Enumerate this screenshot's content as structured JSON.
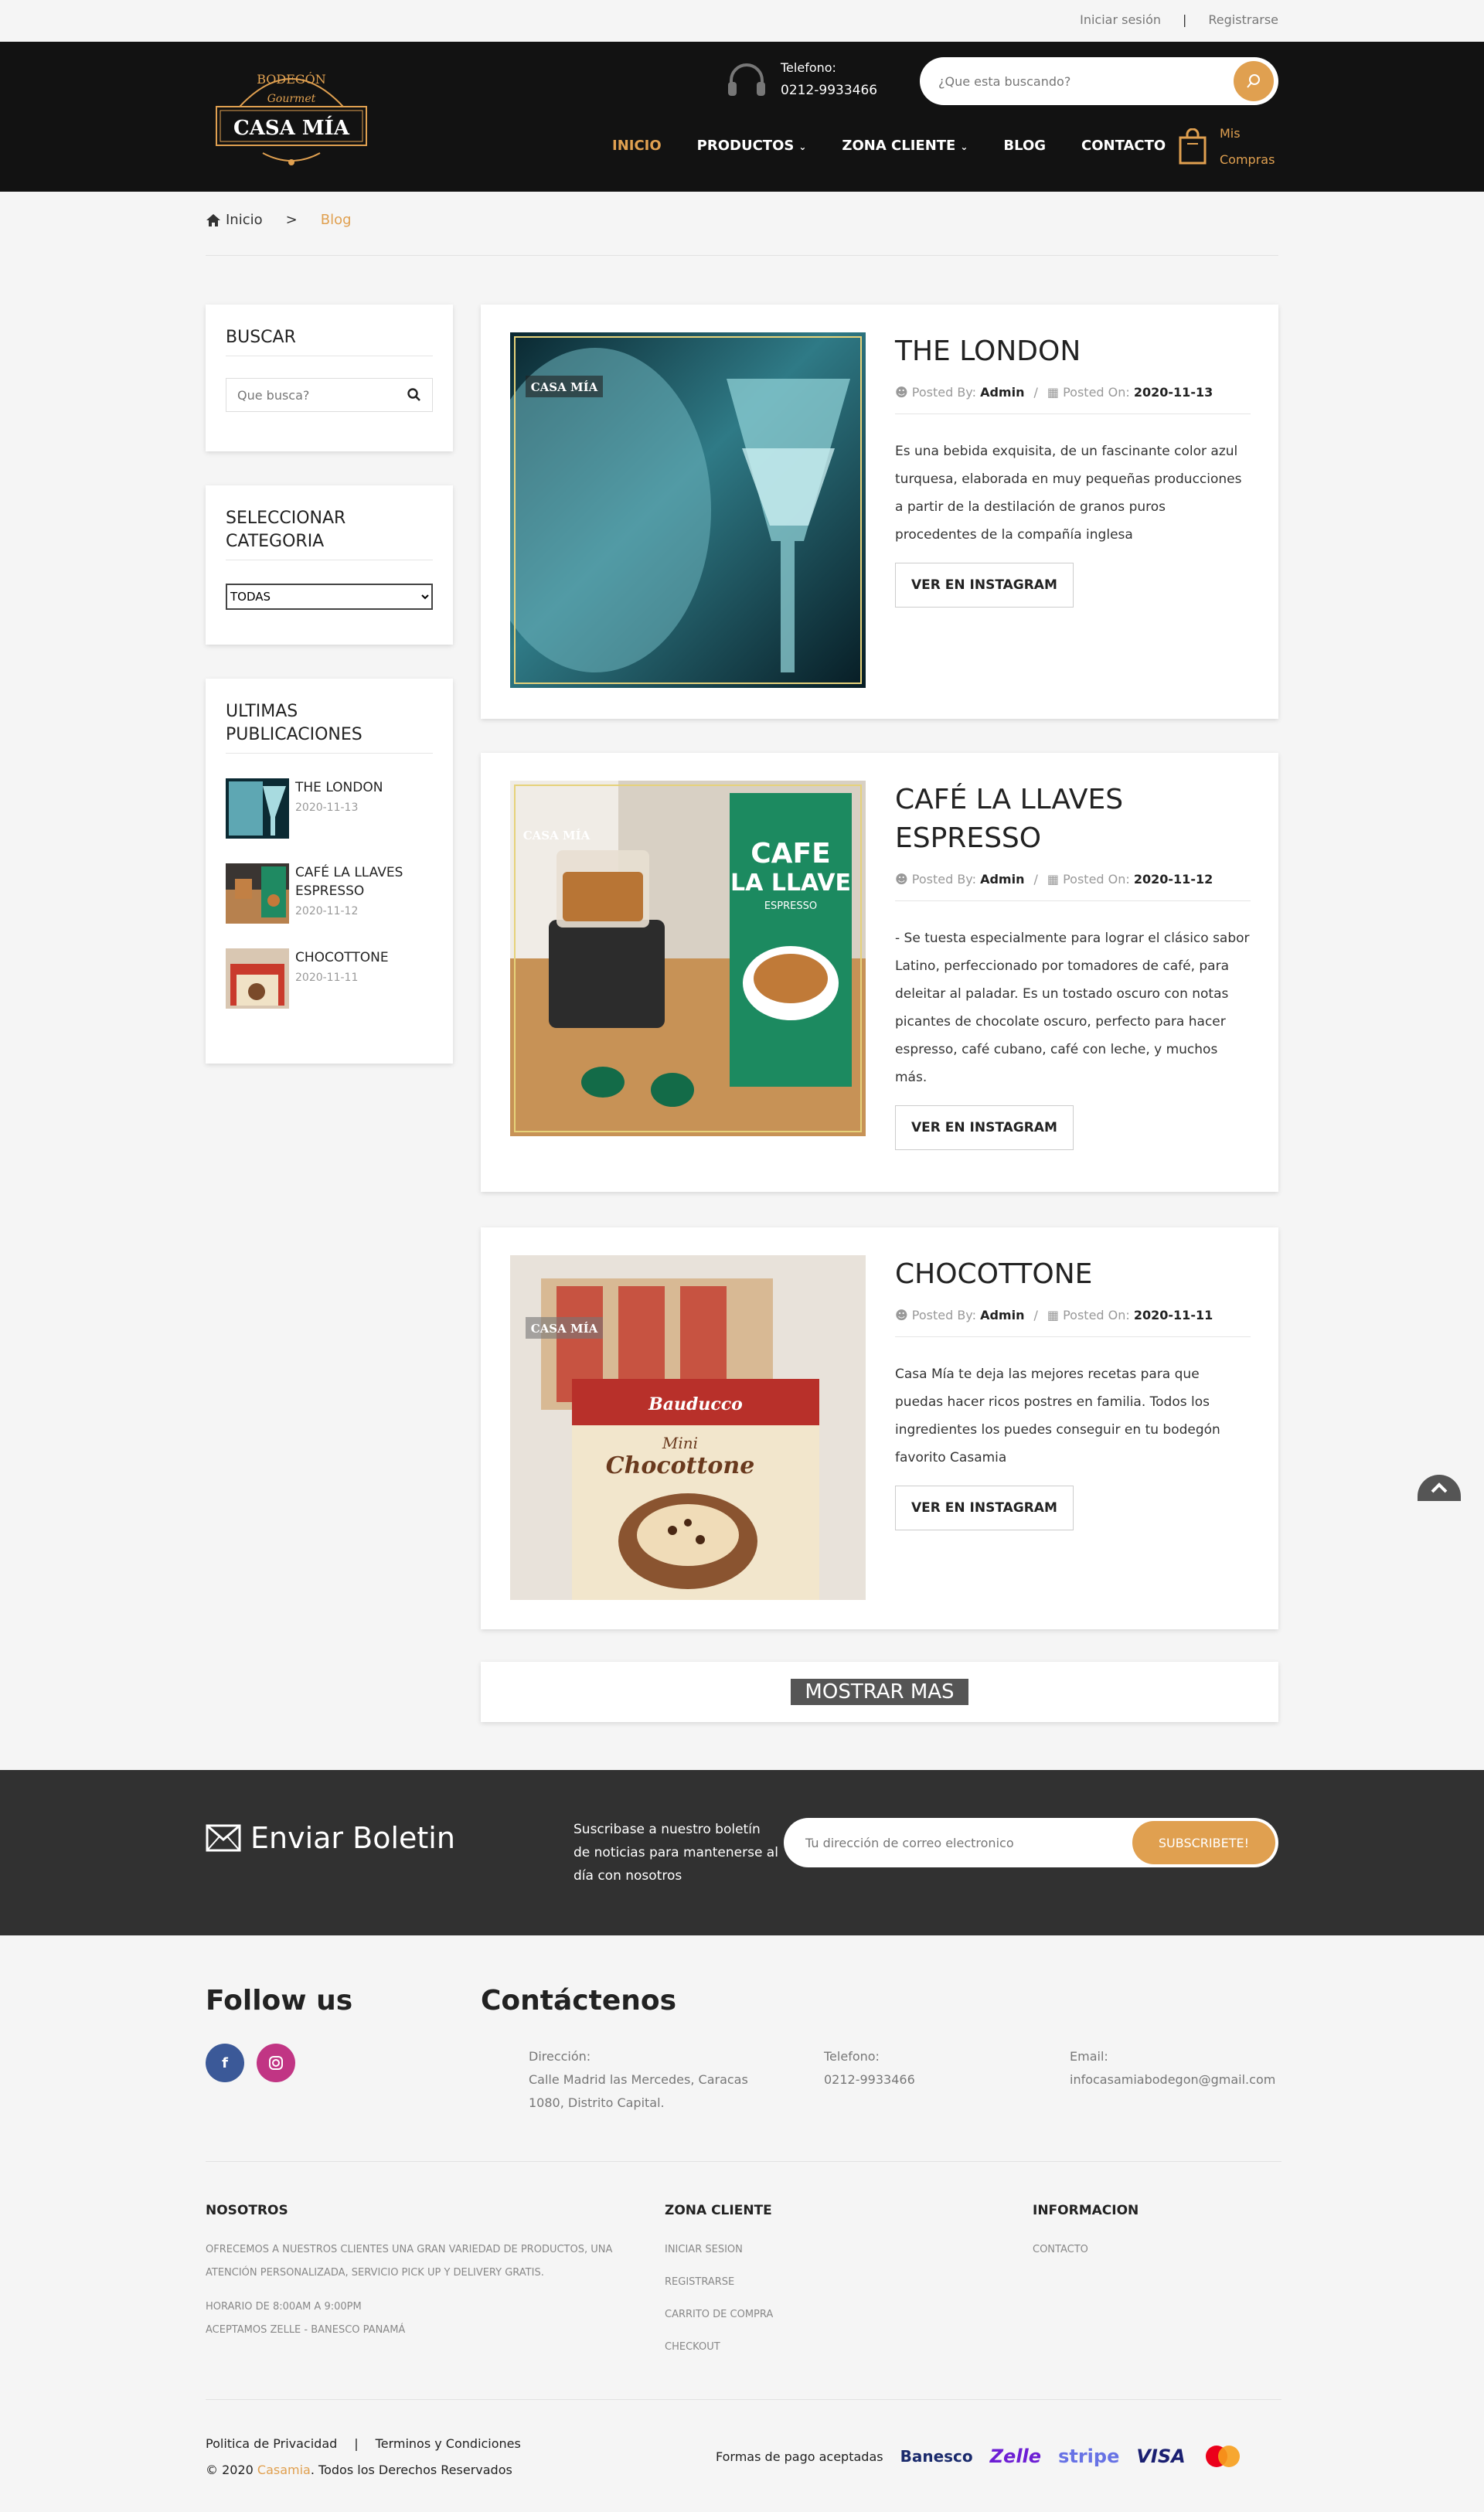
{
  "topbar": {
    "login": "Iniciar sesión",
    "separator": "|",
    "register": "Registrarse"
  },
  "header": {
    "logo": {
      "top": "BODEGÓN",
      "script": "Gourmet",
      "name": "CASA MÍA"
    },
    "phone_label": "Telefono:",
    "phone_number": "0212-9933466",
    "search_placeholder": "¿Que esta buscando?",
    "nav": [
      {
        "label": "INICIO"
      },
      {
        "label": "PRODUCTOS"
      },
      {
        "label": "ZONA CLIENTE"
      },
      {
        "label": "BLOG"
      },
      {
        "label": "CONTACTO"
      }
    ],
    "cart_line1": "Mis",
    "cart_line2": "Compras"
  },
  "breadcrumb": {
    "home": "Inicio",
    "separator": ">",
    "current": "Blog"
  },
  "sidebar": {
    "search_title": "BUSCAR",
    "search_placeholder": "Que busca?",
    "category_title": "SELECCIONAR CATEGORIA",
    "category_selected": "TODAS",
    "recent_title": "ULTIMAS PUBLICACIONES",
    "recent": [
      {
        "title": "THE LONDON",
        "date": "2020-11-13"
      },
      {
        "title": "CAFÉ LA LLAVES ESPRESSO",
        "date": "2020-11-12"
      },
      {
        "title": "CHOCOTTONE",
        "date": "2020-11-11"
      }
    ]
  },
  "posts": [
    {
      "title": "THE LONDON",
      "posted_by_label": "Posted By:",
      "author": "Admin",
      "posted_on_label": "Posted On:",
      "date": "2020-11-13",
      "excerpt": "Es una bebida exquisita, de un fascinante color azul turquesa, elaborada en muy pequeñas producciones a partir de la destilación de granos puros procedentes de la compañía inglesa",
      "button": "VER EN INSTAGRAM",
      "image_watermark": "CASA MÍA"
    },
    {
      "title": "CAFÉ LA LLAVES ESPRESSO",
      "posted_by_label": "Posted By:",
      "author": "Admin",
      "posted_on_label": "Posted On:",
      "date": "2020-11-12",
      "excerpt": "- Se tuesta especialmente para lograr el clásico sabor Latino, perfeccionado por tomadores de café, para deleitar al paladar. Es un tostado oscuro con notas picantes de chocolate oscuro, perfecto para hacer espresso, café cubano, café con leche, y muchos más.",
      "button": "VER EN INSTAGRAM",
      "image_watermark": "CASA MÍA",
      "box_text_1": "CAFE",
      "box_text_2": "LA LLAVE",
      "box_text_3": "ESPRESSO"
    },
    {
      "title": "CHOCOTTONE",
      "posted_by_label": "Posted By:",
      "author": "Admin",
      "posted_on_label": "Posted On:",
      "date": "2020-11-11",
      "excerpt": "Casa Mía te deja las mejores recetas para que puedas hacer ricos postres en familia. Todos los ingredientes los puedes conseguir en tu bodegón favorito Casamia",
      "button": "VER EN INSTAGRAM",
      "image_watermark": "CASA MÍA",
      "box_brand": "Bauducco",
      "box_text_1": "Mini",
      "box_text_2": "Chocottone"
    }
  ],
  "show_more": "MOSTRAR MAS",
  "newsletter": {
    "title": "Enviar Boletin",
    "text": "Suscribase a nuestro boletín de noticias para mantenerse al día con nosotros",
    "placeholder": "Tu dirección de correo electronico",
    "button": "SUBSCRIBETE!"
  },
  "footer": {
    "follow_title": "Follow us",
    "facebook": "f",
    "contact_title": "Contáctenos",
    "address_label": "Dirección:",
    "address_line1": "Calle Madrid las Mercedes, Caracas",
    "address_line2": "1080, Distrito Capital.",
    "phone_label": "Telefono:",
    "phone": "0212-9933466",
    "email_label": "Email:",
    "email": "infocasamiabodegon@gmail.com",
    "nosotros_title": "NOSOTROS",
    "nosotros_text": "OFRECEMOS A NUESTROS CLIENTES UNA GRAN VARIEDAD DE PRODUCTOS, UNA ATENCIÓN PERSONALIZADA, SERVICIO PICK UP Y DELIVERY GRATIS.",
    "horario": "HORARIO DE 8:00AM A 9:00PM",
    "aceptamos": "ACEPTAMOS ZELLE - BANESCO PANAMÁ",
    "zona_title": "ZONA CLIENTE",
    "zona_links": [
      "INICIAR SESION",
      "REGISTRARSE",
      "CARRITO DE COMPRA",
      "CHECKOUT"
    ],
    "info_title": "INFORMACION",
    "info_links": [
      "CONTACTO"
    ],
    "privacy": "Politica de Privacidad",
    "bottom_sep": "|",
    "terms": "Terminos y Condiciones",
    "copy_prefix": "© 2020",
    "copy_brand": "Casamia",
    "copy_suffix": ". Todos los Derechos Reservados",
    "payments_label": "Formas de pago aceptadas",
    "payments": [
      "Banesco",
      "Zelle",
      "stripe",
      "VISA"
    ]
  },
  "colors": {
    "accent": "#e0a050",
    "header_bg": "#121212",
    "newsletter_bg": "#313131"
  }
}
